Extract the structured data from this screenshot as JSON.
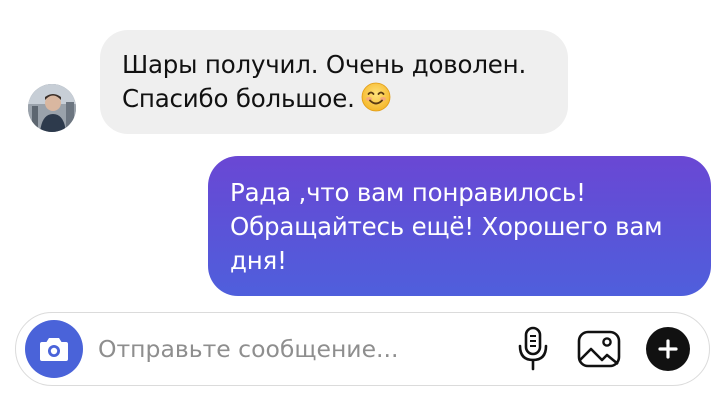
{
  "conversation": {
    "incoming": {
      "line1": "Шары получил. Очень доволен.",
      "line2": "Спасибо большое.",
      "emoji_icon": "smiling-face-emoji"
    },
    "outgoing": {
      "line1": "Рада ,что вам понравилось!",
      "line2": "Обращайтесь ещё! Хорошего вам",
      "line3": "дня!"
    }
  },
  "composer": {
    "placeholder": "Отправьте сообщение...",
    "value": "",
    "camera_icon": "camera-icon",
    "mic_icon": "microphone-icon",
    "gallery_icon": "image-gallery-icon",
    "plus_icon": "plus-icon"
  },
  "colors": {
    "incoming_bubble": "#efefef",
    "outgoing_gradient_top": "#6a47d4",
    "outgoing_gradient_bottom": "#4f5fdc",
    "camera_button": "#4a63d9"
  }
}
